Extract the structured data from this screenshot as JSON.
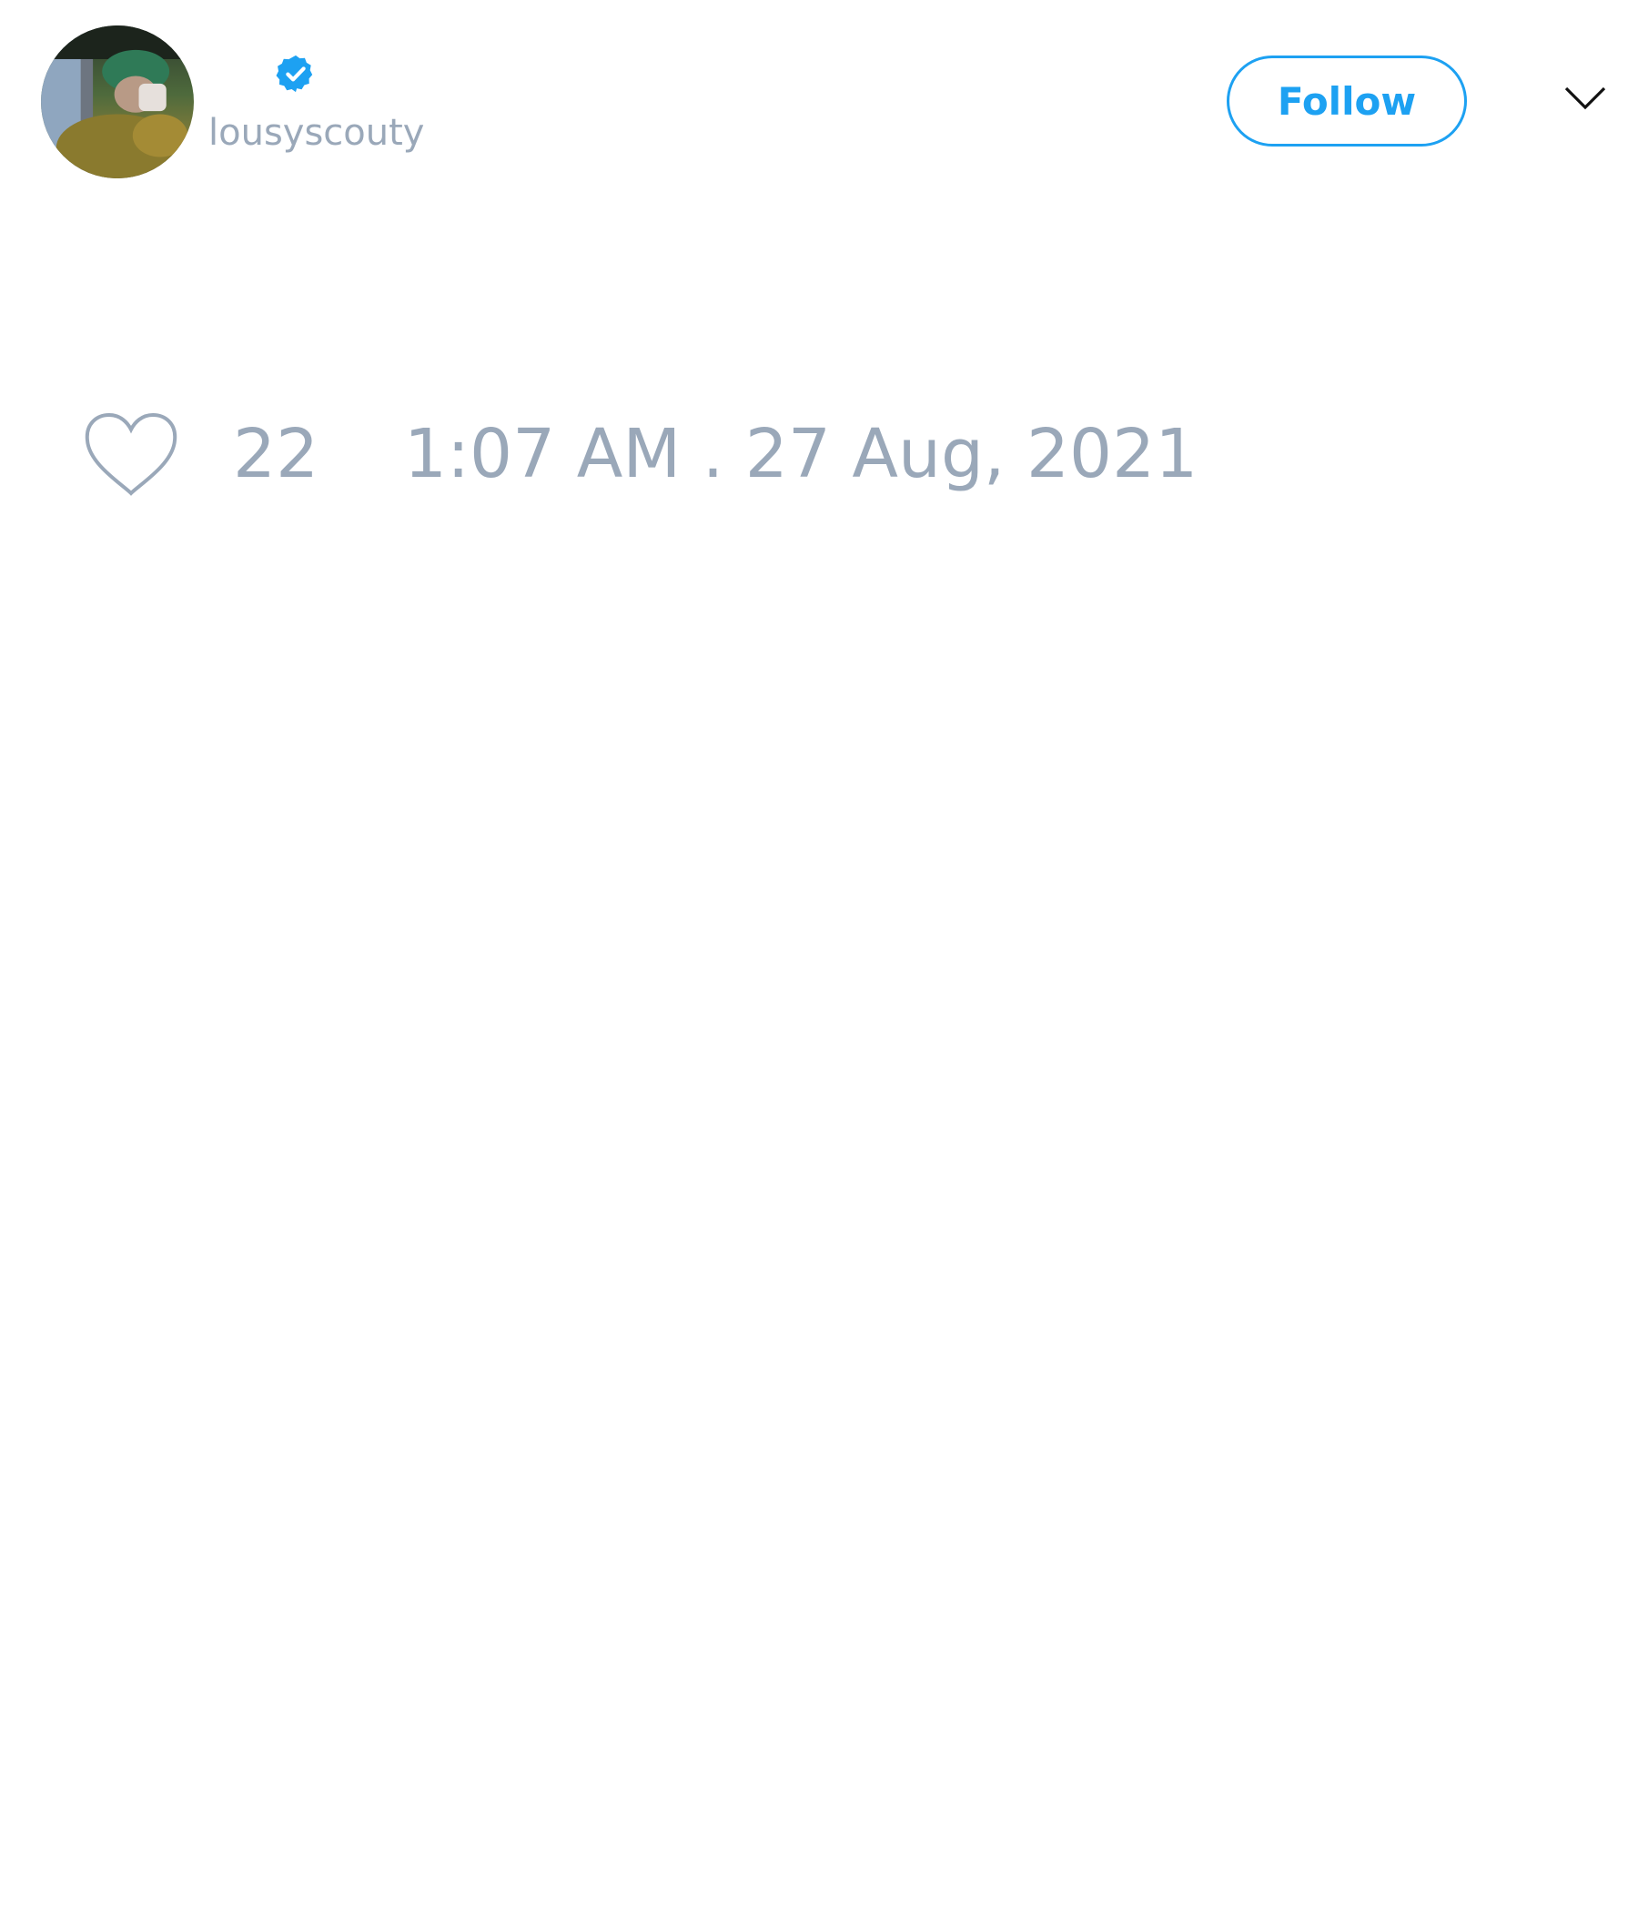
{
  "author": {
    "handle": "lousyscouty",
    "verified": true,
    "avatar_icon": "profile-photo"
  },
  "actions": {
    "follow_label": "Follow",
    "menu_icon": "chevron-down-icon"
  },
  "stats": {
    "like_icon": "heart-outline-icon",
    "like_count": "22",
    "timestamp": "1:07 AM . 27 Aug, 2021"
  },
  "colors": {
    "accent": "#1da1f2",
    "muted_text": "#9aa8b9",
    "background": "#ffffff"
  }
}
